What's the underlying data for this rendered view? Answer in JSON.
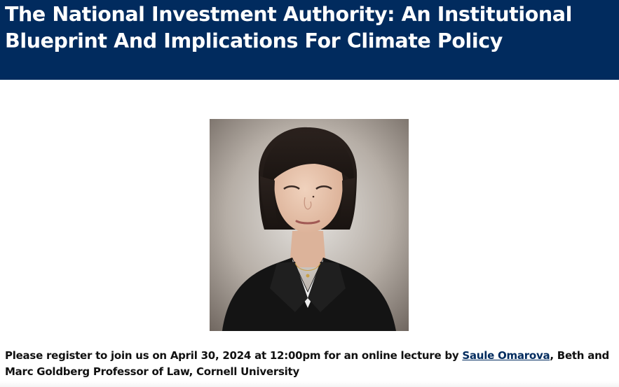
{
  "header": {
    "title": "The National Investment Authority: An Institutional Blueprint And Implications For Climate Policy"
  },
  "event": {
    "intro": "Please register to join us on April 30, 2024 at 12:00pm for an online lecture by ",
    "speaker_name": "Saule Omarova",
    "speaker_title": ", Beth and Marc Goldberg Professor of Law, Cornell University"
  },
  "colors": {
    "banner": "#012b5e",
    "link": "#012b5e"
  }
}
